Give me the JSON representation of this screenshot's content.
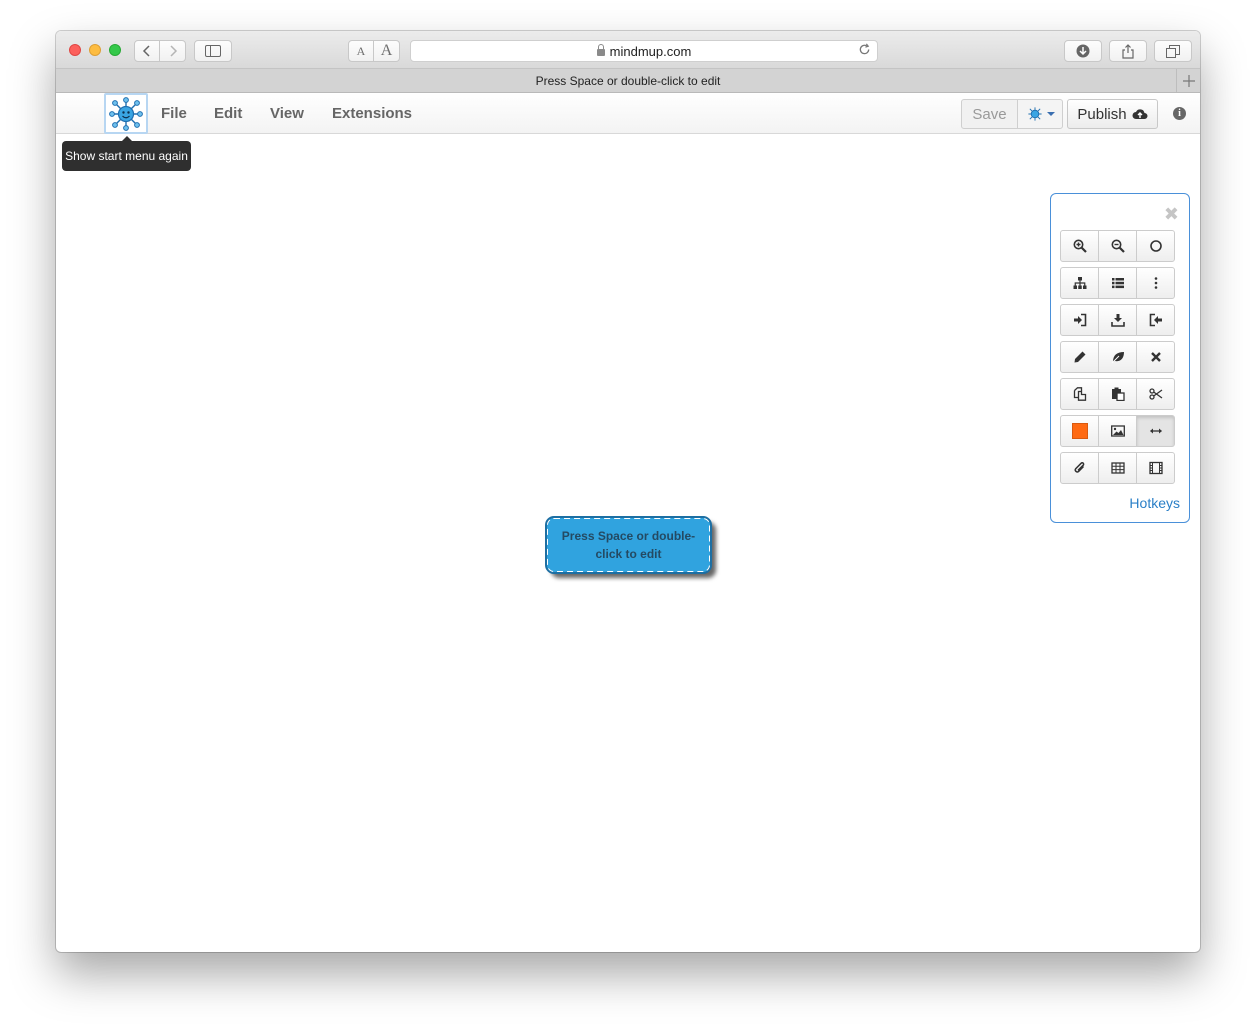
{
  "browser": {
    "url": "mindmup.com",
    "tab_title": "Press Space or double-click to edit",
    "font_small": "A",
    "font_large": "A"
  },
  "menu": {
    "file": "File",
    "edit": "Edit",
    "view": "View",
    "extensions": "Extensions",
    "save": "Save",
    "publish": "Publish",
    "info": "i"
  },
  "tooltip": {
    "text": "Show start menu again"
  },
  "node": {
    "text": "Press Space or double-click to edit"
  },
  "toolbox": {
    "hotkeys": "Hotkeys",
    "rows": [
      [
        "zoom-in-icon",
        "zoom-out-icon",
        "circle-icon"
      ],
      [
        "sitemap-icon",
        "list-icon",
        "vertical-ellipsis-icon"
      ],
      [
        "sign-in-icon",
        "download-icon",
        "sign-out-icon"
      ],
      [
        "pencil-icon",
        "leaf-icon",
        "remove-icon"
      ],
      [
        "copy-icon",
        "paste-icon",
        "scissors-icon"
      ],
      [
        "color-swatch",
        "picture-icon",
        "resize-horizontal-icon"
      ],
      [
        "paperclip-icon",
        "table-icon",
        "film-icon"
      ]
    ]
  },
  "colors": {
    "node_fill": "#30a3df",
    "swatch": "#ff6a13",
    "accent": "#2a7fc7"
  }
}
